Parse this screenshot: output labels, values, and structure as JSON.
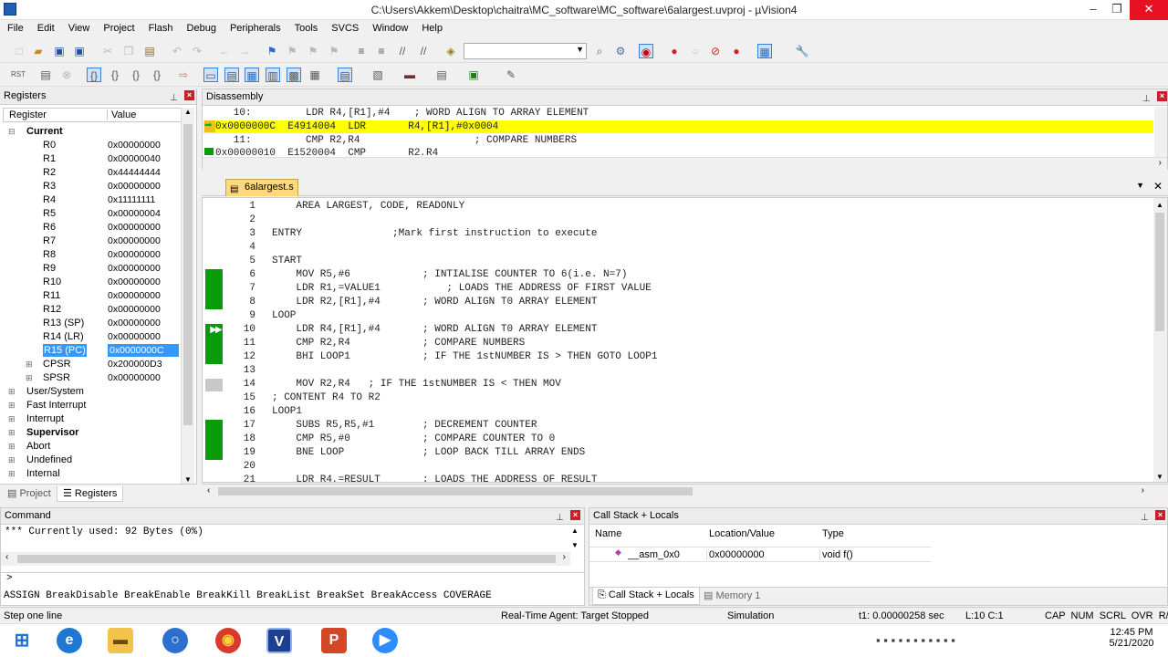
{
  "window": {
    "title": "C:\\Users\\Akkem\\Desktop\\chaitra\\MC_software\\MC_software\\6alargest.uvproj - µVision4"
  },
  "menu": [
    "File",
    "Edit",
    "View",
    "Project",
    "Flash",
    "Debug",
    "Peripherals",
    "Tools",
    "SVCS",
    "Window",
    "Help"
  ],
  "registers": {
    "panel_title": "Registers",
    "col_register": "Register",
    "col_value": "Value",
    "current_label": "Current",
    "rows": [
      {
        "name": "R0",
        "value": "0x00000000"
      },
      {
        "name": "R1",
        "value": "0x00000040"
      },
      {
        "name": "R2",
        "value": "0x44444444"
      },
      {
        "name": "R3",
        "value": "0x00000000"
      },
      {
        "name": "R4",
        "value": "0x11111111"
      },
      {
        "name": "R5",
        "value": "0x00000004"
      },
      {
        "name": "R6",
        "value": "0x00000000"
      },
      {
        "name": "R7",
        "value": "0x00000000"
      },
      {
        "name": "R8",
        "value": "0x00000000"
      },
      {
        "name": "R9",
        "value": "0x00000000"
      },
      {
        "name": "R10",
        "value": "0x00000000"
      },
      {
        "name": "R11",
        "value": "0x00000000"
      },
      {
        "name": "R12",
        "value": "0x00000000"
      },
      {
        "name": "R13 (SP)",
        "value": "0x00000000"
      },
      {
        "name": "R14 (LR)",
        "value": "0x00000000"
      },
      {
        "name": "R15 (PC)",
        "value": "0x0000000C"
      },
      {
        "name": "CPSR",
        "value": "0x200000D3"
      },
      {
        "name": "SPSR",
        "value": "0x00000000"
      }
    ],
    "groups": [
      "User/System",
      "Fast Interrupt",
      "Interrupt",
      "Supervisor",
      "Abort",
      "Undefined",
      "Internal"
    ]
  },
  "left_tabs": {
    "project": "Project",
    "registers": "Registers"
  },
  "disassembly": {
    "title": "Disassembly",
    "lines": [
      "   10:         LDR R4,[R1],#4    ; WORD ALIGN TO ARRAY ELEMENT",
      "0x0000000C  E4914004  LDR       R4,[R1],#0x0004",
      "   11:         CMP R2,R4                   ; COMPARE NUMBERS",
      "0x00000010  E1520004  CMP       R2,R4"
    ]
  },
  "editor": {
    "tab": "6alargest.s",
    "line_numbers": [
      "1",
      "2",
      "3",
      "4",
      "5",
      "6",
      "7",
      "8",
      "9",
      "10",
      "11",
      "12",
      "13",
      "14",
      "15",
      "16",
      "17",
      "18",
      "19",
      "20",
      "21"
    ],
    "lines": [
      "    AREA LARGEST, CODE, READONLY",
      "",
      "ENTRY               ;Mark first instruction to execute",
      "",
      "START",
      "    MOV R5,#6            ; INTIALISE COUNTER TO 6(i.e. N=7)",
      "    LDR R1,=VALUE1           ; LOADS THE ADDRESS OF FIRST VALUE",
      "    LDR R2,[R1],#4       ; WORD ALIGN T0 ARRAY ELEMENT",
      "LOOP",
      "    LDR R4,[R1],#4       ; WORD ALIGN T0 ARRAY ELEMENT",
      "    CMP R2,R4            ; COMPARE NUMBERS",
      "    BHI LOOP1            ; IF THE 1stNUMBER IS > THEN GOTO LOOP1",
      "",
      "    MOV R2,R4   ; IF THE 1stNUMBER IS < THEN MOV",
      "; CONTENT R4 TO R2",
      "LOOP1",
      "    SUBS R5,R5,#1        ; DECREMENT COUNTER",
      "    CMP R5,#0            ; COMPARE COUNTER TO 0",
      "    BNE LOOP             ; LOOP BACK TILL ARRAY ENDS",
      "",
      "    LDR R4,=RESULT       ; LOADS THE ADDRESS OF RESULT"
    ]
  },
  "command": {
    "title": "Command",
    "output": "*** Currently used: 92 Bytes (0%)",
    "prompt": ">",
    "hint": "ASSIGN BreakDisable BreakEnable BreakKill BreakList BreakSet BreakAccess COVERAGE"
  },
  "callstack": {
    "title": "Call Stack + Locals",
    "col_name": "Name",
    "col_loc": "Location/Value",
    "col_type": "Type",
    "row": {
      "name": "__asm_0x0",
      "loc": "0x00000000",
      "type": "void f()"
    },
    "tab1": "Call Stack + Locals",
    "tab2": "Memory 1"
  },
  "status": {
    "left": "Step one line",
    "agent": "Real-Time Agent: Target Stopped",
    "mode": "Simulation",
    "time": "t1: 0.00000258 sec",
    "pos": "L:10 C:1",
    "keys": "CAP  NUM  SCRL  OVR  R/W"
  },
  "taskbar": {
    "time": "12:45 PM",
    "date": "5/21/2020"
  },
  "colors": {
    "highlight": "#ffff00",
    "breakbar": "#0a9a0a",
    "selection": "#3399ff",
    "tab": "#ffd97a"
  }
}
